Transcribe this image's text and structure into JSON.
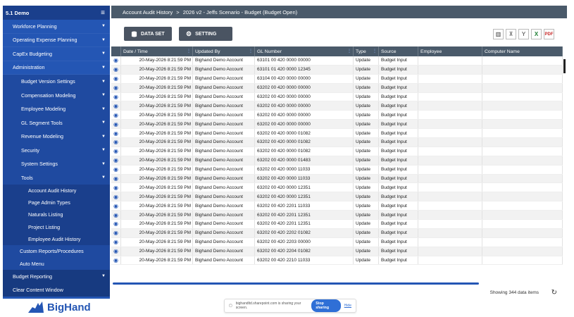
{
  "sidebar": {
    "title": "5.1 Demo",
    "items": [
      {
        "label": "Workforce Planning",
        "level": 0,
        "caret": true
      },
      {
        "label": "Operating Expense Planning",
        "level": 0,
        "caret": true
      },
      {
        "label": "CapEx Budgeting",
        "level": 0,
        "caret": true
      },
      {
        "label": "Administration",
        "level": 0,
        "caret": true
      },
      {
        "label": "Budget Version Settings",
        "level": 1,
        "caret": true
      },
      {
        "label": "Compensation Modeling",
        "level": 1,
        "caret": true
      },
      {
        "label": "Employee Modeling",
        "level": 1,
        "caret": true
      },
      {
        "label": "GL Segment Tools",
        "level": 1,
        "caret": true
      },
      {
        "label": "Revenue Modeling",
        "level": 1,
        "caret": true
      },
      {
        "label": "Security",
        "level": 1,
        "caret": true
      },
      {
        "label": "System Settings",
        "level": 1,
        "caret": true
      },
      {
        "label": "Tools",
        "level": 1,
        "caret": true
      },
      {
        "label": "Account Audit History",
        "level": 2,
        "caret": false
      },
      {
        "label": "Page Admin Types",
        "level": 2,
        "caret": false
      },
      {
        "label": "Naturals Listing",
        "level": 2,
        "caret": false
      },
      {
        "label": "Project Listing",
        "level": 2,
        "caret": false
      },
      {
        "label": "Employee Audit History",
        "level": 2,
        "caret": false
      },
      {
        "label": "Custom Reports/Procedures",
        "level": "1b",
        "caret": false
      },
      {
        "label": "Auto Menu",
        "level": "1b",
        "caret": false
      }
    ],
    "bottom": [
      {
        "label": "Budget Reporting",
        "caret": true
      },
      {
        "label": "Clear Content Window",
        "caret": false
      }
    ]
  },
  "breadcrumb": {
    "page": "Account Audit History",
    "sep": ">",
    "path": "2026 v2 - Jeffs Scenario - Budget (Budget Open)"
  },
  "toolbar": {
    "dataset_label": "DATA SET",
    "setting_label": "SETTING"
  },
  "grid": {
    "columns": [
      "",
      "Date / Time",
      "Updated By",
      "GL Number",
      "Type",
      "Source",
      "Employee",
      "Computer Name"
    ],
    "rows": [
      [
        "20-May-2026 8:21:59 PM",
        "Bighand Demo Account",
        "63101 00 420 0000 00000",
        "Update",
        "Budget Input"
      ],
      [
        "20-May-2026 8:21:59 PM",
        "Bighand Demo Account",
        "63101 01 420 0000 12345",
        "Update",
        "Budget Input"
      ],
      [
        "20-May-2026 8:21:59 PM",
        "Bighand Demo Account",
        "63104 00 420 0000 00000",
        "Update",
        "Budget Input"
      ],
      [
        "20-May-2026 8:21:59 PM",
        "Bighand Demo Account",
        "63202 00 420 0000 00000",
        "Update",
        "Budget Input"
      ],
      [
        "20-May-2026 8:21:59 PM",
        "Bighand Demo Account",
        "63202 00 420 0000 00000",
        "Update",
        "Budget Input"
      ],
      [
        "20-May-2026 8:21:59 PM",
        "Bighand Demo Account",
        "63202 00 420 0000 00000",
        "Update",
        "Budget Input"
      ],
      [
        "20-May-2026 8:21:59 PM",
        "Bighand Demo Account",
        "63202 00 420 0000 00000",
        "Update",
        "Budget Input"
      ],
      [
        "20-May-2026 8:21:59 PM",
        "Bighand Demo Account",
        "63202 00 420 0000 00000",
        "Update",
        "Budget Input"
      ],
      [
        "20-May-2026 8:21:59 PM",
        "Bighand Demo Account",
        "63202 00 420 0000 01082",
        "Update",
        "Budget Input"
      ],
      [
        "20-May-2026 8:21:59 PM",
        "Bighand Demo Account",
        "63202 00 420 0000 01082",
        "Update",
        "Budget Input"
      ],
      [
        "20-May-2026 8:21:59 PM",
        "Bighand Demo Account",
        "63202 00 420 0000 01082",
        "Update",
        "Budget Input"
      ],
      [
        "20-May-2026 8:21:59 PM",
        "Bighand Demo Account",
        "63202 00 420 0000 01483",
        "Update",
        "Budget Input"
      ],
      [
        "20-May-2026 8:21:59 PM",
        "Bighand Demo Account",
        "63202 00 420 0000 11033",
        "Update",
        "Budget Input"
      ],
      [
        "20-May-2026 8:21:59 PM",
        "Bighand Demo Account",
        "63202 00 420 0000 11033",
        "Update",
        "Budget Input"
      ],
      [
        "20-May-2026 8:21:59 PM",
        "Bighand Demo Account",
        "63202 00 420 0000 12351",
        "Update",
        "Budget Input"
      ],
      [
        "20-May-2026 8:21:59 PM",
        "Bighand Demo Account",
        "63202 00 420 0000 12351",
        "Update",
        "Budget Input"
      ],
      [
        "20-May-2026 8:21:59 PM",
        "Bighand Demo Account",
        "63202 00 420 2201 11033",
        "Update",
        "Budget Input"
      ],
      [
        "20-May-2026 8:21:59 PM",
        "Bighand Demo Account",
        "63202 00 420 2201 12351",
        "Update",
        "Budget Input"
      ],
      [
        "20-May-2026 8:21:59 PM",
        "Bighand Demo Account",
        "63202 00 420 2201 12351",
        "Update",
        "Budget Input"
      ],
      [
        "20-May-2026 8:21:59 PM",
        "Bighand Demo Account",
        "63202 00 420 2202 01082",
        "Update",
        "Budget Input"
      ],
      [
        "20-May-2026 8:21:59 PM",
        "Bighand Demo Account",
        "63202 00 420 2203 00000",
        "Update",
        "Budget Input"
      ],
      [
        "20-May-2026 8:21:59 PM",
        "Bighand Demo Account",
        "63202 00 420 2204 01082",
        "Update",
        "Budget Input"
      ],
      [
        "20-May-2026 8:21:59 PM",
        "Bighand Demo Account",
        "63202 00 420 2210 11033",
        "Update",
        "Budget Input"
      ]
    ]
  },
  "status": {
    "count_text": "Showing 344 data items"
  },
  "share": {
    "text": "bighandltd.sharepoint.com is sharing your screen.",
    "stop_label": "Stop sharing",
    "hide_label": "Hide"
  },
  "logo": {
    "text": "BigHand"
  },
  "icons": {
    "row_view": "eye-icon",
    "menu": "hamburger-icon",
    "refresh": "refresh-icon"
  },
  "colors": {
    "sidebar": "#2456b4",
    "header": "#4a5a6a",
    "accent": "#2456b4"
  }
}
